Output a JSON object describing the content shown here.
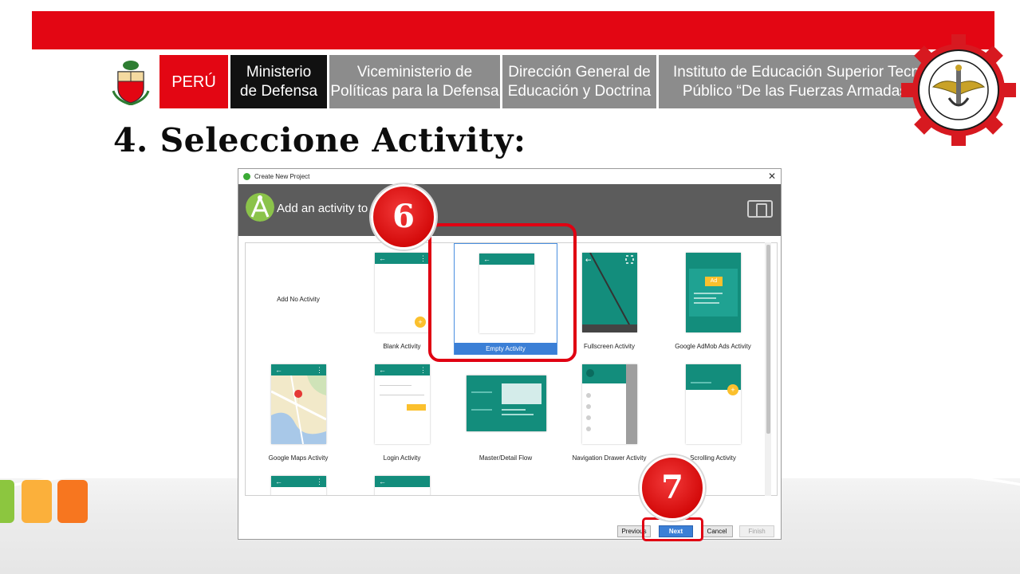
{
  "header": {
    "peru": "PERÚ",
    "ministerio": [
      "Ministerio",
      "de Defensa"
    ],
    "viceministerio": [
      "Viceministerio de",
      "Políticas para la Defensa"
    ],
    "direccion": [
      "Dirección General de",
      "Educación y Doctrina"
    ],
    "instituto": [
      "Instituto de Educación Superior Tecnológ",
      "Público “De las Fuerzas Armadas”"
    ]
  },
  "slide_title": "4. Seleccione Activity:",
  "window": {
    "title": "Create New Project",
    "close_glyph": "✕",
    "banner_text": "Add an activity to"
  },
  "activities": [
    "Add No Activity",
    "Blank Activity",
    "Empty Activity",
    "Fullscreen Activity",
    "Google AdMob Ads Activity",
    "Google Maps Activity",
    "Login Activity",
    "Master/Detail Flow",
    "Navigation Drawer Activity",
    "Scrolling Activity"
  ],
  "selected_activity": "Empty Activity",
  "buttons": {
    "previous": "Previous",
    "next": "Next",
    "cancel": "Cancel",
    "finish": "Finish"
  },
  "annotations": {
    "step_6": "6",
    "step_7": "7"
  },
  "ad_label": "Ad",
  "colors": {
    "brand_red": "#e30613",
    "android_teal": "#138d7c",
    "selection_blue": "#3b7fd6",
    "header_gray": "#8c8c8c"
  }
}
